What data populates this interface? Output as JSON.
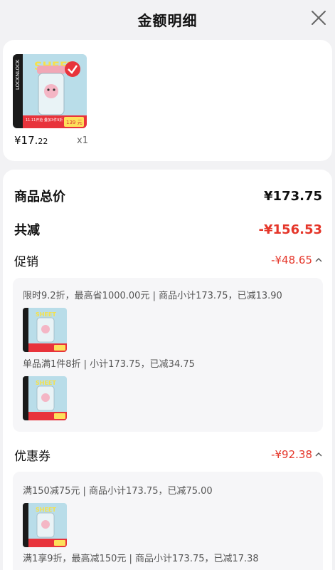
{
  "header": {
    "title": "金额明细"
  },
  "product": {
    "price_main": "¥17.",
    "price_decimal": "22",
    "quantity": "x1",
    "badge_line1": "11.11开抢 叠加3件9折",
    "badge_price": "139 元"
  },
  "summary": {
    "total_label": "商品总价",
    "total_value": "¥173.75",
    "discount_label": "共减",
    "discount_value": "-¥156.53"
  },
  "promotion": {
    "label": "促销",
    "value": "-¥48.65",
    "rules": [
      "限时9.2折，最高省1000.00元 | 商品小计173.75，已减13.90",
      "单品满1件8折 | 小计173.75，已减34.75"
    ]
  },
  "coupon": {
    "label": "优惠券",
    "value": "-¥92.38",
    "rules": [
      "满150减75元 | 商品小计173.75，已减75.00",
      "满1享9折，最高减150元 | 商品小计173.75，已减17.38"
    ]
  },
  "colors": {
    "accent_red": "#e5362a",
    "background": "#f2f2f4",
    "card": "#ffffff"
  },
  "icons": {
    "close": "close-icon",
    "caret": "chevron-up-icon",
    "check": "check-badge-icon"
  }
}
